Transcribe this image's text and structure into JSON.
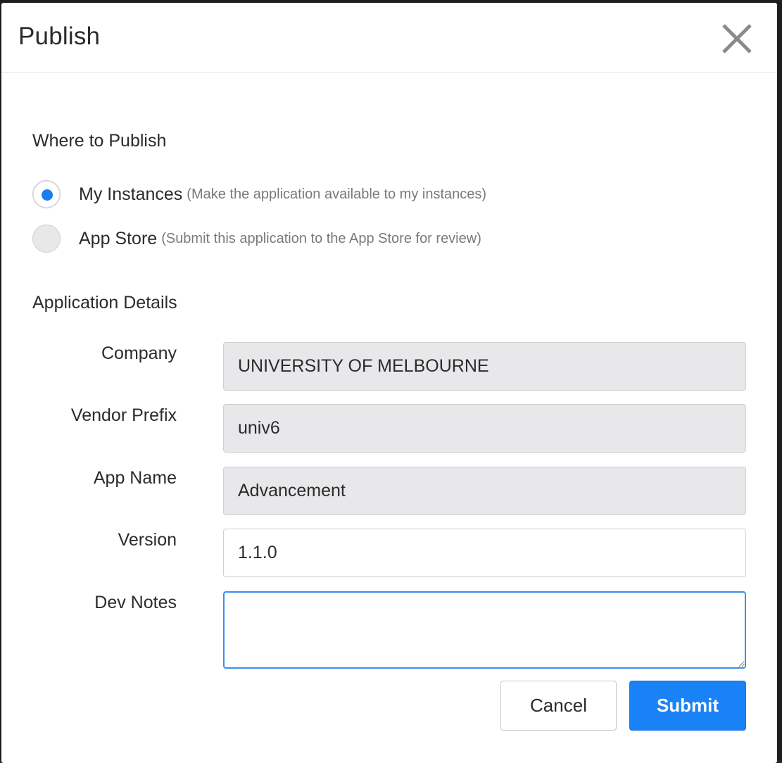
{
  "dialog": {
    "title": "Publish",
    "close_icon": "close-icon"
  },
  "where_to_publish": {
    "heading": "Where to Publish",
    "options": [
      {
        "label": "My Instances",
        "hint": "(Make the application available to my instances)",
        "selected": true
      },
      {
        "label": "App Store",
        "hint": "(Submit this application to the App Store for review)",
        "selected": false
      }
    ]
  },
  "application_details": {
    "heading": "Application Details",
    "company": {
      "label": "Company",
      "value": "UNIVERSITY OF MELBOURNE"
    },
    "vendor_prefix": {
      "label": "Vendor Prefix",
      "value": "univ6"
    },
    "app_name": {
      "label": "App Name",
      "value": "Advancement"
    },
    "version": {
      "label": "Version",
      "value": "1.1.0"
    },
    "dev_notes": {
      "label": "Dev Notes",
      "value": ""
    }
  },
  "actions": {
    "cancel_label": "Cancel",
    "submit_label": "Submit"
  },
  "colors": {
    "accent": "#1a82f7",
    "readonly_field_bg": "#e8e8ea",
    "focus_border": "#3b8df0"
  }
}
